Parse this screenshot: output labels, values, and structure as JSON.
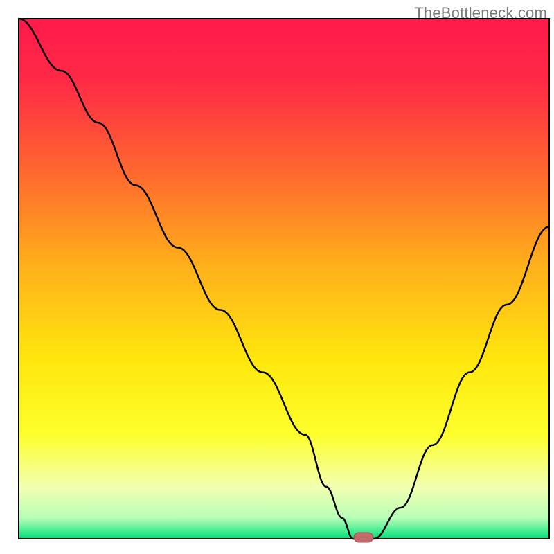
{
  "attribution": "TheBottleneck.com",
  "chart_data": {
    "type": "line",
    "title": "",
    "xlabel": "",
    "ylabel": "",
    "xlim": [
      0,
      100
    ],
    "ylim": [
      0,
      100
    ],
    "grid": false,
    "legend": false,
    "background": {
      "stops": [
        {
          "pos": 0.0,
          "color": "#ff1a4b"
        },
        {
          "pos": 0.12,
          "color": "#ff2a46"
        },
        {
          "pos": 0.3,
          "color": "#ff6a2e"
        },
        {
          "pos": 0.48,
          "color": "#ffb21a"
        },
        {
          "pos": 0.66,
          "color": "#ffe80e"
        },
        {
          "pos": 0.8,
          "color": "#fdff2c"
        },
        {
          "pos": 0.9,
          "color": "#f2ffb0"
        },
        {
          "pos": 0.96,
          "color": "#b8ffb8"
        },
        {
          "pos": 1.0,
          "color": "#00e07a"
        }
      ]
    },
    "series": [
      {
        "name": "bottleneck-curve",
        "x": [
          0,
          8,
          15,
          22,
          30,
          38,
          46,
          54,
          58,
          61,
          63,
          67,
          72,
          78,
          85,
          92,
          100
        ],
        "y": [
          100,
          90,
          80,
          68,
          56,
          44,
          32,
          20,
          10,
          4,
          0,
          0,
          6,
          18,
          32,
          45,
          60
        ]
      }
    ],
    "marker": {
      "name": "optimal-point",
      "x": 65,
      "y": 0,
      "color": "#c26a6a",
      "shape": "pill"
    }
  }
}
